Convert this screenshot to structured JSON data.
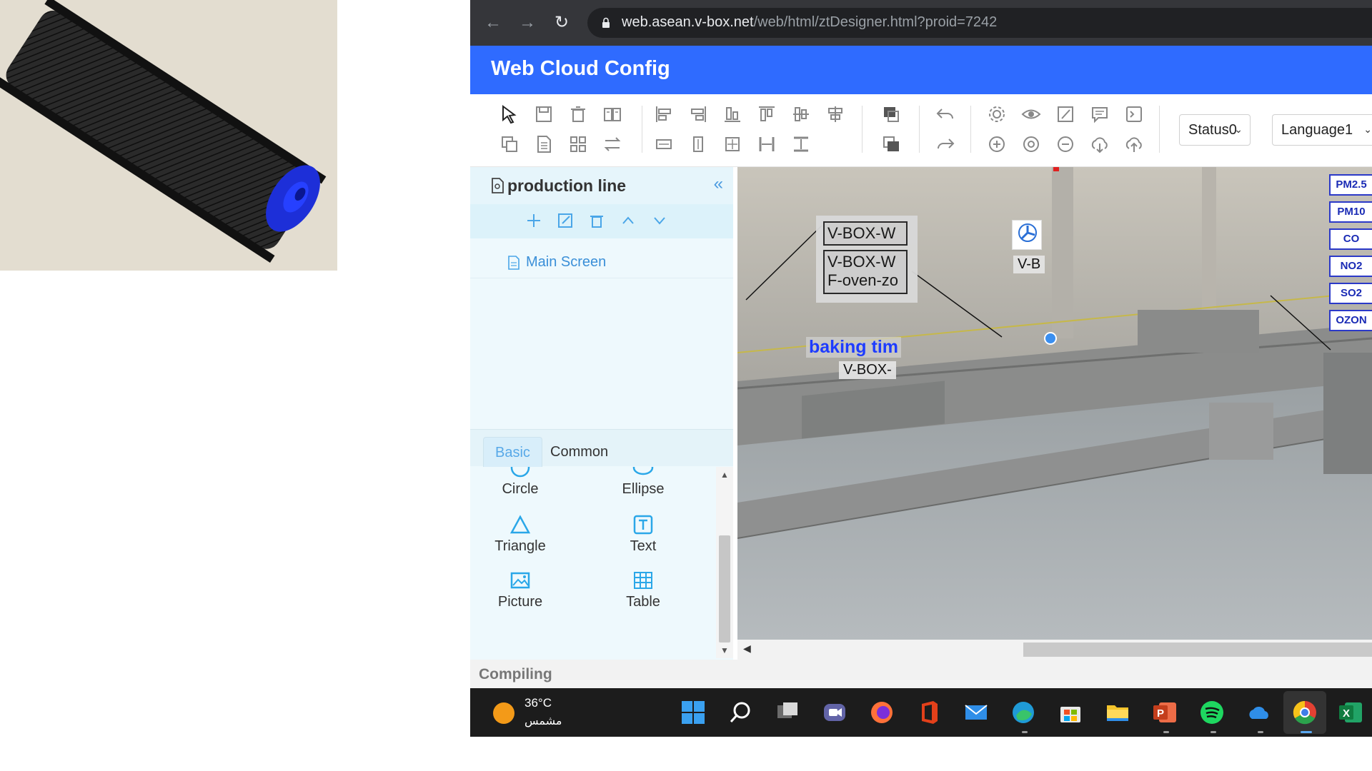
{
  "browser": {
    "url_host": "web.asean.v-box.net",
    "url_path": "/web/html/ztDesigner.html?proid=7242"
  },
  "app": {
    "title": "Web Cloud Config"
  },
  "toolbar": {
    "status_select": "Status0",
    "language_select": "Language1"
  },
  "sidebar": {
    "title": "production line",
    "screens": [
      {
        "label": "Main Screen"
      }
    ]
  },
  "tabs": [
    {
      "label": "Basic"
    },
    {
      "label": "Common"
    }
  ],
  "palette": [
    {
      "label": "Circle",
      "icon": "circle-icon"
    },
    {
      "label": "Ellipse",
      "icon": "ellipse-icon"
    },
    {
      "label": "Triangle",
      "icon": "triangle-icon"
    },
    {
      "label": "Text",
      "icon": "text-icon"
    },
    {
      "label": "Picture",
      "icon": "picture-icon"
    },
    {
      "label": "Table",
      "icon": "table-icon"
    }
  ],
  "status": "Compiling",
  "canvas": {
    "vbox_1": "V-BOX-W",
    "vbox_2": "V-BOX-W",
    "vbox_2_sub": "F-oven-zo",
    "vbox_b": "V-B",
    "vbox_c": "V-BOX-",
    "baking": "baking tim",
    "sensors": [
      "PM2.5",
      "PM10",
      "CO",
      "NO2",
      "SO2",
      "OZON"
    ]
  },
  "taskbar": {
    "temperature": "36°C",
    "weather": "مشمس"
  },
  "colors": {
    "header_blue": "#2f6bff",
    "accent_blue": "#3a8fd8",
    "sensor_border": "#2b39c8"
  }
}
